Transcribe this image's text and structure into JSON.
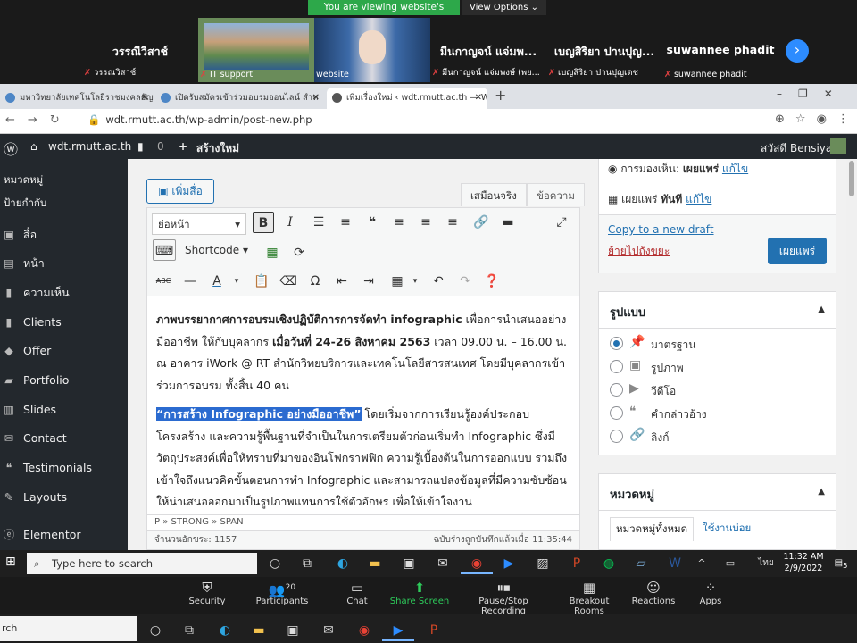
{
  "zoom": {
    "banner": "You are viewing website's screen",
    "view_options": "View Options",
    "gallery": [
      {
        "big": "วรรณีวิสาช์",
        "small": "วรรณวิสาช์"
      },
      {
        "big": "",
        "small": "IT support"
      },
      {
        "big": "",
        "small": "website"
      },
      {
        "big": "มีนกาญจน์ แจ่มพ...",
        "small": "มีนกาญจน์ แจ่มพงษ์ (พย..."
      },
      {
        "big": "เบญสิริยา ปานปุญ...",
        "small": "เบญสิริยา ปานปุญเดช"
      },
      {
        "big": "suwannee phadit",
        "small": "suwannee phadit"
      }
    ],
    "controls": [
      {
        "label": "Security",
        "icon": "shield-icon"
      },
      {
        "label": "Participants",
        "icon": "participants-icon",
        "count": "20"
      },
      {
        "label": "Chat",
        "icon": "chat-icon"
      },
      {
        "label": "Share Screen",
        "icon": "share-screen-icon"
      },
      {
        "label": "Pause/Stop Recording",
        "icon": "pause-icon"
      },
      {
        "label": "Breakout Rooms",
        "icon": "breakout-icon"
      },
      {
        "label": "Reactions",
        "icon": "reaction-icon"
      },
      {
        "label": "Apps",
        "icon": "apps-icon"
      }
    ]
  },
  "browser": {
    "tabs": [
      {
        "title": "มหาวิทยาลัยเทคโนโลยีราชมงคลธัญบุรี"
      },
      {
        "title": "เปิดรับสมัครเข้าร่วมอบรมออนไลน์ สำห"
      },
      {
        "title": "เพิ่มเรื่องใหม่ ‹ wdt.rmutt.ac.th — W"
      }
    ],
    "url": "wdt.rmutt.ac.th/wp-admin/post-new.php"
  },
  "wp": {
    "site": "wdt.rmutt.ac.th",
    "comments_count": "0",
    "new_label": "สร้างใหม่",
    "greeting": "สวัสดี Bensiya",
    "sidebar": [
      {
        "label": "หมวดหมู่",
        "plain": true
      },
      {
        "label": "ป้ายกำกับ",
        "plain": true
      },
      {
        "label": "สื่อ",
        "icon": "media-icon"
      },
      {
        "label": "หน้า",
        "icon": "pages-icon"
      },
      {
        "label": "ความเห็น",
        "icon": "comments-icon"
      },
      {
        "label": "Clients",
        "icon": "clients-icon"
      },
      {
        "label": "Offer",
        "icon": "offer-icon"
      },
      {
        "label": "Portfolio",
        "icon": "portfolio-icon"
      },
      {
        "label": "Slides",
        "icon": "slides-icon"
      },
      {
        "label": "Contact",
        "icon": "contact-icon"
      },
      {
        "label": "Testimonials",
        "icon": "testimonials-icon"
      },
      {
        "label": "Layouts",
        "icon": "layouts-icon"
      },
      {
        "label": "Elementor",
        "icon": "elementor-icon"
      }
    ],
    "add_media": "เพิ่มสื่อ",
    "tab_visual": "เสมือนจริง",
    "tab_text": "ข้อความ",
    "format_select": "ย่อหน้า",
    "shortcode": "Shortcode",
    "para1_bold": "ภาพบรรยากาศการอบรมเชิงปฏิบัติการการจัดทำ infographic",
    "para1_a": " เพื่อการนำเสนออย่างมืออาชีพ ให้กับบุคลากร ",
    "para1_date": "เมื่อวันที่ 24-26 สิงหาคม 2563",
    "para1_b": " เวลา 09.00 น. – 16.00 น. ณ อาคาร iWork @ RT สำนักวิทยบริการและเทคโนโลยีสารสนเทศ โดยมีบุคลากรเข้าร่วมการอบรม ทั้งสิ้น 40 คน",
    "para2_hl": "“การสร้าง Infographic อย่างมืออาชีพ”",
    "para2_rest": " โดยเริ่มจากการเรียนรู้องค์ประกอบ โครงสร้าง และความรู้พื้นฐานที่จำเป็นในการเตรียมตัวก่อนเริ่มทำ Infographic ซึ่งมีวัตถุประสงค์เพื่อให้ทราบที่มาของอินโฟกราฟฟิก ความรู้เบื้องต้นในการออกแบบ รวมถึงเข้าใจถึงแนวคิดขั้นตอนการทำ Infographic และสามารถแปลงข้อมูลที่มีความซับซ้อนให้น่าเสนอออกมาเป็นรูปภาพแทนการใช้ตัวอักษร เพื่อให้เข้าใจงาน",
    "path": "P » STRONG » SPAN",
    "word_count": "จำนวนอักขระ: 1157",
    "draft_saved": "ฉบับร่างถูกบันทึกแล้วเมื่อ 11:35:44",
    "visibility_label": "การมองเห็น:",
    "visibility_value": "เผยแพร่",
    "edit": "แก้ไข",
    "publish_label": "เผยแพร่",
    "publish_value": "ทันที",
    "copy_draft": "Copy to a new draft",
    "trash": "ย้ายไปถังขยะ",
    "publish_btn": "เผยแพร่",
    "format_title": "รูปแบบ",
    "formats": [
      "มาตรฐาน",
      "รูปภาพ",
      "วีดีโอ",
      "คำกล่าวอ้าง",
      "ลิงก์"
    ],
    "cats_title": "หมวดหมู่",
    "cats_all": "หมวดหมู่ทั้งหมด",
    "cats_common": "ใช้งานบ่อย"
  },
  "windows": {
    "search_placeholder": "Type here to search",
    "lang": "ไทย",
    "time": "11:32 AM",
    "date": "2/9/2022",
    "notif": "5",
    "bottom_search": "rch"
  }
}
